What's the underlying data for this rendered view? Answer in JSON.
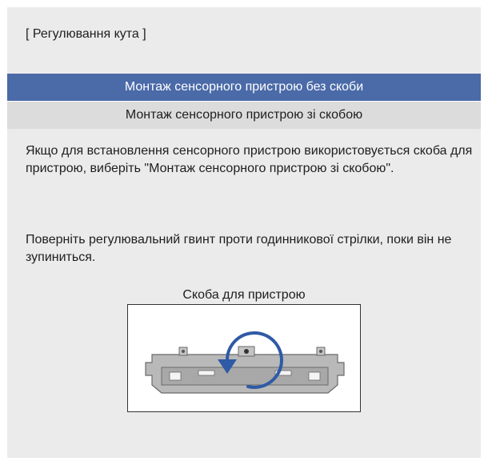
{
  "dialog": {
    "title": "[ Регулювання кута ]",
    "menu": {
      "selected_label": "Монтаж сенсорного пристрою без скоби",
      "other_label": "Монтаж сенсорного пристрою зі скобою"
    },
    "description_1": "Якщо для встановлення сенсорного пристрою використовується скоба для пристрою, виберіть \"Монтаж сенсорного пристрою зі скобою\".",
    "description_2": "Поверніть регулювальний гвинт проти годинникової стрілки, поки він не зупиниться.",
    "figure_caption": "Скоба для пристрою"
  },
  "colors": {
    "panel_background": "#ebebeb",
    "selected_item": "#4a6aa8",
    "unselected_item": "#dcdcdc",
    "arrow": "#2f5aa5"
  },
  "icons": {
    "rotation_arrow": "counterclockwise-arrow-icon",
    "bracket": "device-bracket-illustration"
  }
}
